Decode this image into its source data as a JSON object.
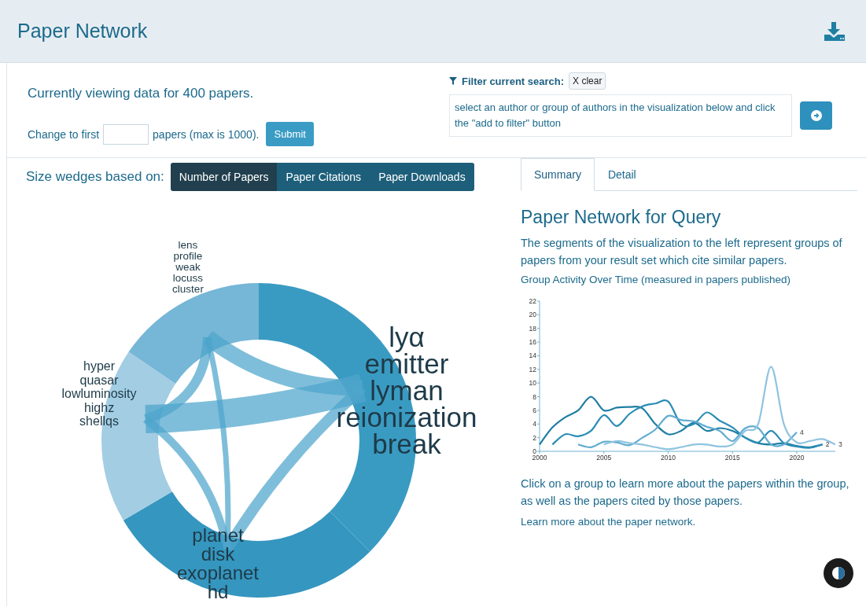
{
  "header": {
    "title": "Paper Network"
  },
  "summary": {
    "viewing": "Currently viewing data for 400 papers.",
    "change_label": "Change to first",
    "change_suffix": "papers (max is 1000).",
    "submit": "Submit"
  },
  "filter": {
    "label": "Filter current search:",
    "clear": "X clear",
    "hint": "select an author or group of authors in the visualization below and click the \"add to filter\" button"
  },
  "size_by": {
    "label": "Size wedges based on:",
    "options": [
      {
        "label": "Number of Papers",
        "selected": true
      },
      {
        "label": "Paper Citations",
        "selected": false
      },
      {
        "label": "Paper Downloads",
        "selected": false
      }
    ]
  },
  "network": {
    "groups": [
      {
        "keywords": [
          "lyα",
          "emitter",
          "lyman",
          "reionization",
          "break"
        ],
        "color": "#3a9bc2"
      },
      {
        "keywords": [
          "planet",
          "disk",
          "exoplanet",
          "hd"
        ],
        "color": "#3596bf"
      },
      {
        "keywords": [
          "hyper",
          "quasar",
          "lowluminosity",
          "highz",
          "shellqs"
        ],
        "color": "#a3cde3"
      },
      {
        "keywords": [
          "lens",
          "profile",
          "weak",
          "locuss",
          "cluster"
        ],
        "color": "#76b6d7"
      }
    ]
  },
  "side_tabs": [
    {
      "label": "Summary",
      "selected": true
    },
    {
      "label": "Detail",
      "selected": false
    }
  ],
  "side": {
    "heading": "Paper Network for Query",
    "intro": "The segments of the visualization to the left represent groups of papers from your result set which cite similar papers.",
    "chart_caption": "Group Activity Over Time (measured in papers published)",
    "chart_data": {
      "type": "line",
      "xlim": [
        2000,
        2023
      ],
      "ylim": [
        0,
        22
      ],
      "xticks": [
        2000,
        2005,
        2010,
        2015,
        2020
      ],
      "yticks": [
        0,
        2,
        4,
        6,
        8,
        10,
        12,
        14,
        16,
        18,
        20,
        22
      ],
      "x": [
        2000,
        2001,
        2002,
        2003,
        2004,
        2005,
        2006,
        2007,
        2008,
        2009,
        2010,
        2011,
        2012,
        2013,
        2014,
        2015,
        2016,
        2017,
        2018,
        2019,
        2020,
        2021,
        2022,
        2023
      ],
      "series": [
        {
          "color": "#1f7ea3",
          "values": [
            1,
            3.5,
            5,
            6,
            8,
            6,
            6.4,
            6.5,
            6.3,
            4,
            2.5,
            3,
            4.2,
            3,
            3.4,
            3,
            2,
            1.2,
            1,
            1.2,
            0.8,
            0.6,
            1,
            null
          ]
        },
        {
          "name": "2",
          "color": "#2a8db5",
          "values": [
            null,
            1,
            2.5,
            2.2,
            3,
            5.3,
            3.7,
            5.5,
            6.6,
            7,
            7.3,
            4,
            4,
            5.7,
            4.5,
            3.5,
            2,
            1.3,
            3,
            1.2,
            0.7,
            0.5,
            1,
            null
          ]
        },
        {
          "name": "4",
          "color": "#62acd0",
          "values": [
            null,
            null,
            null,
            1,
            0.6,
            1.4,
            1.3,
            0.9,
            2,
            3.2,
            5.2,
            4.6,
            4.4,
            3.6,
            3,
            1.5,
            3.4,
            3.4,
            1,
            1,
            2.8,
            null,
            null,
            null
          ]
        },
        {
          "name": "3",
          "color": "#8fc4e0",
          "values": [
            null,
            null,
            null,
            null,
            null,
            1,
            1.5,
            1.2,
            1,
            0.6,
            0.3,
            0.6,
            1,
            1,
            0.7,
            1,
            3,
            4,
            12.4,
            4,
            1.3,
            1.5,
            1.8,
            1
          ]
        }
      ]
    },
    "click_note": "Click on a group to learn more about the papers within the group, as well as the papers cited by those papers.",
    "learn_more": "Learn more about the paper network."
  }
}
